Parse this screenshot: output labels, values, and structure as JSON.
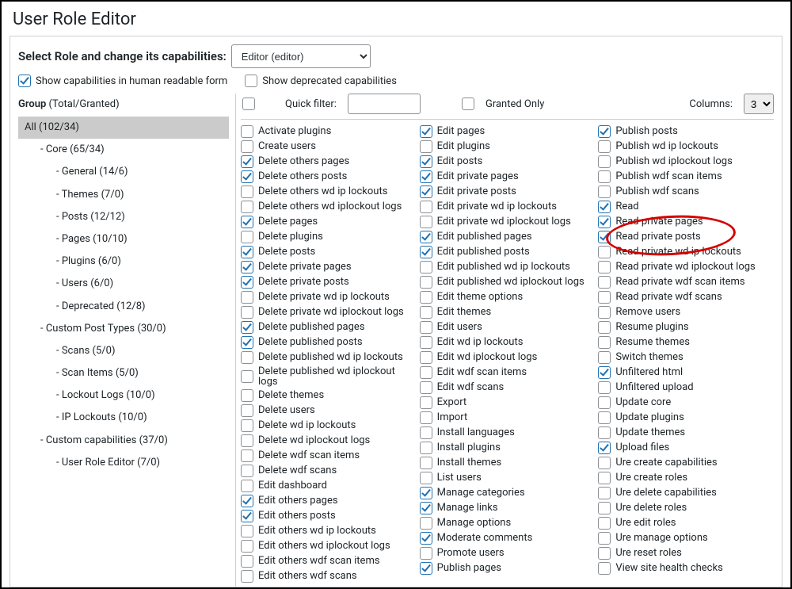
{
  "title": "User Role Editor",
  "select_label": "Select Role and change its capabilities:",
  "role_selected": "Editor (editor)",
  "show_human_readable": {
    "label": "Show capabilities in human readable form",
    "checked": true
  },
  "show_deprecated": {
    "label": "Show deprecated capabilities",
    "checked": false
  },
  "group_header_label": "Group",
  "group_header_suffix": "(Total/Granted)",
  "groups": [
    {
      "label": "All (102/34)",
      "level": 0,
      "selected": true
    },
    {
      "label": "- Core (65/34)",
      "level": 1
    },
    {
      "label": "- General (14/6)",
      "level": 2
    },
    {
      "label": "- Themes (7/0)",
      "level": 2
    },
    {
      "label": "- Posts (12/12)",
      "level": 2
    },
    {
      "label": "- Pages (10/10)",
      "level": 2
    },
    {
      "label": "- Plugins (6/0)",
      "level": 2
    },
    {
      "label": "- Users (6/0)",
      "level": 2
    },
    {
      "label": "- Deprecated (12/8)",
      "level": 2
    },
    {
      "label": "- Custom Post Types (30/0)",
      "level": 1
    },
    {
      "label": "- Scans (5/0)",
      "level": 2
    },
    {
      "label": "- Scan Items (5/0)",
      "level": 2
    },
    {
      "label": "- Lockout Logs (10/0)",
      "level": 2
    },
    {
      "label": "- IP Lockouts (10/0)",
      "level": 2
    },
    {
      "label": "- Custom capabilities (37/0)",
      "level": 1
    },
    {
      "label": "- User Role Editor (7/0)",
      "level": 2
    }
  ],
  "filter": {
    "quick_filter_label": "Quick filter:",
    "quick_filter_value": "",
    "granted_only_label": "Granted Only",
    "granted_only_checked": false,
    "columns_label": "Columns:",
    "columns_value": "3",
    "select_all_checked": false
  },
  "caps": {
    "col1": [
      {
        "label": "Activate plugins",
        "checked": false
      },
      {
        "label": "Create users",
        "checked": false
      },
      {
        "label": "Delete others pages",
        "checked": true
      },
      {
        "label": "Delete others posts",
        "checked": true
      },
      {
        "label": "Delete others wd ip lockouts",
        "checked": false
      },
      {
        "label": "Delete others wd iplockout logs",
        "checked": false
      },
      {
        "label": "Delete pages",
        "checked": true
      },
      {
        "label": "Delete plugins",
        "checked": false
      },
      {
        "label": "Delete posts",
        "checked": true
      },
      {
        "label": "Delete private pages",
        "checked": true
      },
      {
        "label": "Delete private posts",
        "checked": true
      },
      {
        "label": "Delete private wd ip lockouts",
        "checked": false
      },
      {
        "label": "Delete private wd iplockout logs",
        "checked": false
      },
      {
        "label": "Delete published pages",
        "checked": true
      },
      {
        "label": "Delete published posts",
        "checked": true
      },
      {
        "label": "Delete published wd ip lockouts",
        "checked": false
      },
      {
        "label": "Delete published wd iplockout logs",
        "checked": false
      },
      {
        "label": "Delete themes",
        "checked": false
      },
      {
        "label": "Delete users",
        "checked": false
      },
      {
        "label": "Delete wd ip lockouts",
        "checked": false
      },
      {
        "label": "Delete wd iplockout logs",
        "checked": false
      },
      {
        "label": "Delete wdf scan items",
        "checked": false
      },
      {
        "label": "Delete wdf scans",
        "checked": false
      },
      {
        "label": "Edit dashboard",
        "checked": false
      },
      {
        "label": "Edit others pages",
        "checked": true
      },
      {
        "label": "Edit others posts",
        "checked": true
      },
      {
        "label": "Edit others wd ip lockouts",
        "checked": false
      },
      {
        "label": "Edit others wd iplockout logs",
        "checked": false
      },
      {
        "label": "Edit others wdf scan items",
        "checked": false
      },
      {
        "label": "Edit others wdf scans",
        "checked": false
      }
    ],
    "col2": [
      {
        "label": "Edit pages",
        "checked": true
      },
      {
        "label": "Edit plugins",
        "checked": false
      },
      {
        "label": "Edit posts",
        "checked": true
      },
      {
        "label": "Edit private pages",
        "checked": true
      },
      {
        "label": "Edit private posts",
        "checked": true
      },
      {
        "label": "Edit private wd ip lockouts",
        "checked": false
      },
      {
        "label": "Edit private wd iplockout logs",
        "checked": false
      },
      {
        "label": "Edit published pages",
        "checked": true
      },
      {
        "label": "Edit published posts",
        "checked": true
      },
      {
        "label": "Edit published wd ip lockouts",
        "checked": false
      },
      {
        "label": "Edit published wd iplockout logs",
        "checked": false
      },
      {
        "label": "Edit theme options",
        "checked": false
      },
      {
        "label": "Edit themes",
        "checked": false
      },
      {
        "label": "Edit users",
        "checked": false
      },
      {
        "label": "Edit wd ip lockouts",
        "checked": false
      },
      {
        "label": "Edit wd iplockout logs",
        "checked": false
      },
      {
        "label": "Edit wdf scan items",
        "checked": false
      },
      {
        "label": "Edit wdf scans",
        "checked": false
      },
      {
        "label": "Export",
        "checked": false
      },
      {
        "label": "Import",
        "checked": false
      },
      {
        "label": "Install languages",
        "checked": false
      },
      {
        "label": "Install plugins",
        "checked": false
      },
      {
        "label": "Install themes",
        "checked": false
      },
      {
        "label": "List users",
        "checked": false
      },
      {
        "label": "Manage categories",
        "checked": true
      },
      {
        "label": "Manage links",
        "checked": true
      },
      {
        "label": "Manage options",
        "checked": false
      },
      {
        "label": "Moderate comments",
        "checked": true
      },
      {
        "label": "Promote users",
        "checked": false
      },
      {
        "label": "Publish pages",
        "checked": true
      }
    ],
    "col3": [
      {
        "label": "Publish posts",
        "checked": true
      },
      {
        "label": "Publish wd ip lockouts",
        "checked": false
      },
      {
        "label": "Publish wd iplockout logs",
        "checked": false
      },
      {
        "label": "Publish wdf scan items",
        "checked": false
      },
      {
        "label": "Publish wdf scans",
        "checked": false
      },
      {
        "label": "Read",
        "checked": true,
        "highlight": false
      },
      {
        "label": "Read private pages",
        "checked": true,
        "highlight": true
      },
      {
        "label": "Read private posts",
        "checked": true,
        "highlight": true
      },
      {
        "label": "Read private wd ip lockouts",
        "checked": false
      },
      {
        "label": "Read private wd iplockout logs",
        "checked": false
      },
      {
        "label": "Read private wdf scan items",
        "checked": false
      },
      {
        "label": "Read private wdf scans",
        "checked": false
      },
      {
        "label": "Remove users",
        "checked": false
      },
      {
        "label": "Resume plugins",
        "checked": false
      },
      {
        "label": "Resume themes",
        "checked": false
      },
      {
        "label": "Switch themes",
        "checked": false
      },
      {
        "label": "Unfiltered html",
        "checked": true
      },
      {
        "label": "Unfiltered upload",
        "checked": false
      },
      {
        "label": "Update core",
        "checked": false
      },
      {
        "label": "Update plugins",
        "checked": false
      },
      {
        "label": "Update themes",
        "checked": false
      },
      {
        "label": "Upload files",
        "checked": true
      },
      {
        "label": "Ure create capabilities",
        "checked": false
      },
      {
        "label": "Ure create roles",
        "checked": false
      },
      {
        "label": "Ure delete capabilities",
        "checked": false
      },
      {
        "label": "Ure delete roles",
        "checked": false
      },
      {
        "label": "Ure edit roles",
        "checked": false
      },
      {
        "label": "Ure manage options",
        "checked": false
      },
      {
        "label": "Ure reset roles",
        "checked": false
      },
      {
        "label": "View site health checks",
        "checked": false
      }
    ]
  }
}
